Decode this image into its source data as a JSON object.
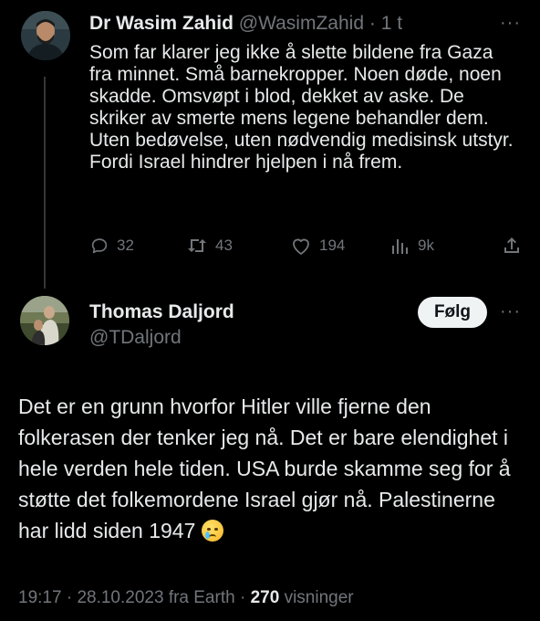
{
  "reply_to_tweet": {
    "author_name": "Dr Wasim Zahid",
    "author_handle": "@WasimZahid",
    "separator": "·",
    "time_ago": "1 t",
    "text": "Som far klarer jeg ikke å slette bildene fra Gaza fra minnet. Små barnekropper. Noen døde, noen skadde. Omsvøpt i blod, dekket av aske. De skriker av smerte mens legene behandler dem. Uten bedøvelse, uten nødvendig medisinsk utstyr. Fordi Israel hindrer hjelpen i nå frem.",
    "replies": "32",
    "reposts": "43",
    "likes": "194",
    "views": "9k"
  },
  "main_tweet": {
    "author_name": "Thomas Daljord",
    "author_handle": "@TDaljord",
    "follow_label": "Følg",
    "text": "Det er en grunn hvorfor Hitler ville fjerne den folkerasen der tenker jeg nå. Det er bare elendighet i hele verden hele tiden. USA burde skamme seg for å støtte det folkemordene Israel gjør nå. Palestinerne har lidd siden 1947",
    "time": "19:17",
    "date": "28.10.2023",
    "source": "fra Earth",
    "views_count": "270",
    "views_label": "visninger"
  },
  "icons": {
    "reply": "reply-icon",
    "repost": "repost-icon",
    "like": "heart-icon",
    "views": "analytics-icon",
    "share": "share-icon",
    "more": "more-icon",
    "emoji": "crying-face-emoji"
  },
  "colors": {
    "background": "#000000",
    "text": "#e7e9ea",
    "secondary": "#71767b",
    "follow_button": "#eff3f4"
  }
}
